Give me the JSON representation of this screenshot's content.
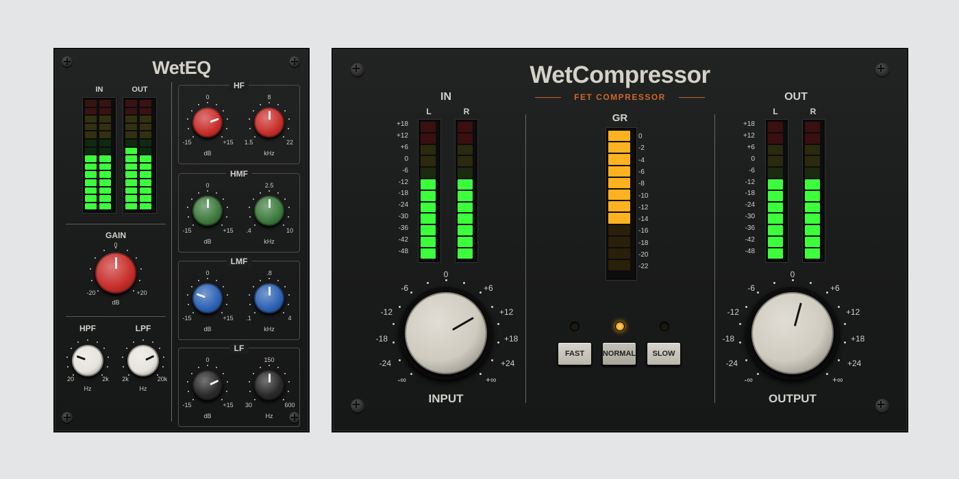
{
  "eq": {
    "title": "WetEQ",
    "meters": {
      "in_label": "IN",
      "out_label": "OUT",
      "in_level_segments": 7,
      "out_level_segments": 8,
      "segment_count": 14
    },
    "gain": {
      "label": "GAIN",
      "top": "0",
      "min": "-20",
      "max": "+20",
      "unit": "dB"
    },
    "hpf": {
      "label": "HPF",
      "min": "20",
      "max": "2k",
      "unit": "Hz"
    },
    "lpf": {
      "label": "LPF",
      "min": "2k",
      "max": "20k",
      "unit": "Hz"
    },
    "bands": [
      {
        "name": "HF",
        "gain_top": "0",
        "gain_min": "-15",
        "gain_max": "+15",
        "gain_unit": "dB",
        "freq_top": "8",
        "freq_min": "1.5",
        "freq_max": "22",
        "freq_unit": "kHz",
        "color": "#c9302c"
      },
      {
        "name": "HMF",
        "gain_top": "0",
        "gain_min": "-15",
        "gain_max": "+15",
        "gain_unit": "dB",
        "freq_top": "2.5",
        "freq_min": ".4",
        "freq_max": "10",
        "freq_unit": "kHz",
        "color": "#3f7c3f"
      },
      {
        "name": "LMF",
        "gain_top": "0",
        "gain_min": "-15",
        "gain_max": "+15",
        "gain_unit": "dB",
        "freq_top": ".8",
        "freq_min": ".1",
        "freq_max": "4",
        "freq_unit": "kHz",
        "color": "#2f63b5"
      },
      {
        "name": "LF",
        "gain_top": "0",
        "gain_min": "-15",
        "gain_max": "+15",
        "gain_unit": "dB",
        "freq_top": "150",
        "freq_min": "30",
        "freq_max": "600",
        "freq_unit": "Hz",
        "color": "#2a2a2a"
      }
    ]
  },
  "comp": {
    "title": "WetCompressor",
    "subtitle": "FET COMPRESSOR",
    "in_label": "IN",
    "out_label": "OUT",
    "gr_label": "GR",
    "left_label": "L",
    "right_label": "R",
    "meter_scale": [
      "+18",
      "+12",
      "+6",
      "0",
      "-6",
      "-12",
      "-18",
      "-24",
      "-30",
      "-36",
      "-42",
      "-48"
    ],
    "gr_scale": [
      "0",
      "-2",
      "-4",
      "-6",
      "-8",
      "-10",
      "-12",
      "-14",
      "-16",
      "-18",
      "-20",
      "-22"
    ],
    "gr_active_segments": 8,
    "meter_active_segments": 7,
    "knob_scale": {
      "top": "0",
      "m6": "-6",
      "m12": "-12",
      "m18": "-18",
      "m24": "-24",
      "minf": "-∞",
      "p6": "+6",
      "p12": "+12",
      "p18": "+18",
      "p24": "+24",
      "pinf": "+∞"
    },
    "input_label": "INPUT",
    "output_label": "OUTPUT",
    "buttons": {
      "fast": "FAST",
      "normal": "NORMAL",
      "slow": "SLOW",
      "active": "normal"
    }
  }
}
